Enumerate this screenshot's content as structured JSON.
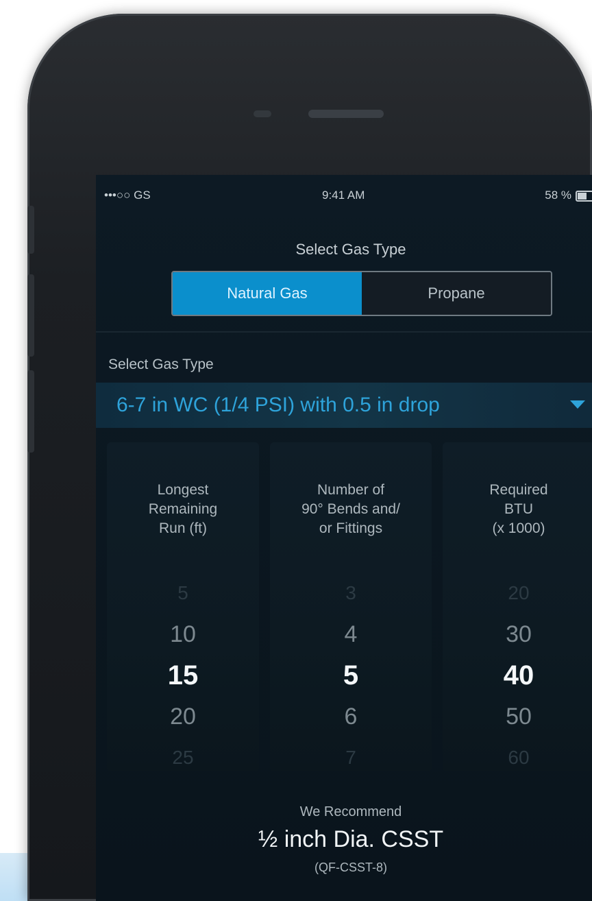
{
  "status_bar": {
    "carrier": "•••○○ GS",
    "time": "9:41 AM",
    "battery": "58 %"
  },
  "gas_type": {
    "title": "Select Gas Type",
    "options": [
      "Natural Gas",
      "Propane"
    ],
    "selected": "Natural Gas"
  },
  "pressure": {
    "label": "Select Gas Type",
    "value": "6-7 in WC (1/4 PSI) with 0.5 in drop"
  },
  "columns": [
    {
      "header": [
        "Longest",
        "Remaining",
        "Run (ft)"
      ],
      "values": [
        "5",
        "10",
        "15",
        "20",
        "25"
      ]
    },
    {
      "header": [
        "Number of",
        "90° Bends and/",
        "or Fittings"
      ],
      "values": [
        "3",
        "4",
        "5",
        "6",
        "7"
      ]
    },
    {
      "header": [
        "Required",
        "BTU",
        "(x 1000)"
      ],
      "values": [
        "20",
        "30",
        "40",
        "50",
        "60"
      ]
    }
  ],
  "recommendation": {
    "label": "We Recommend",
    "value": "½ inch Dia. CSST",
    "code": "(QF-CSST-8)"
  },
  "colors": {
    "accent": "#0b8fcc",
    "dropdown_text": "#2ea3da",
    "screen_bg": "#0b1720"
  }
}
